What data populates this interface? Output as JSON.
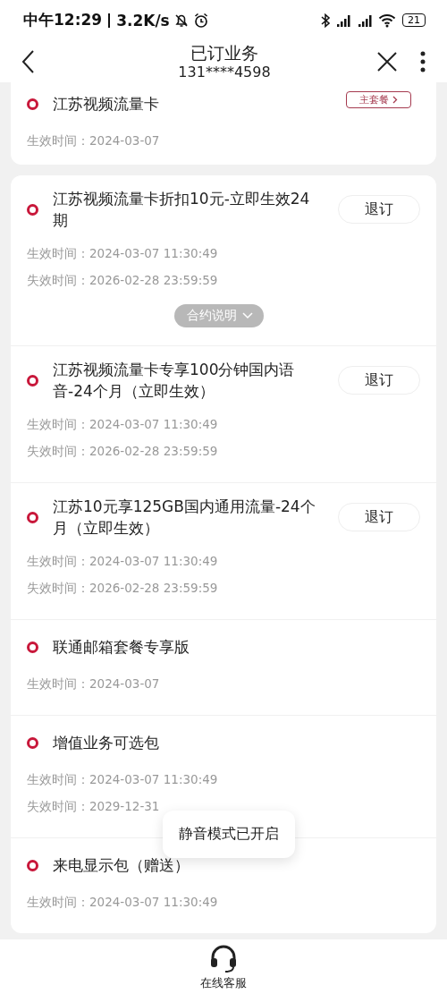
{
  "status_bar": {
    "time": "中午12:29",
    "speed": "3.2K/s",
    "battery": "21"
  },
  "header": {
    "title": "已订业务",
    "subtitle": "131****4598"
  },
  "main_plan": {
    "name": "江苏视频流量卡",
    "badge": "主套餐",
    "dates": [
      "生效时间：2024-03-07"
    ]
  },
  "services": [
    {
      "name": "江苏视频流量卡折扣10元-立即生效24期",
      "action": "退订",
      "dates": [
        "生效时间：2024-03-07 11:30:49",
        "失效时间：2026-02-28 23:59:59"
      ],
      "contract": "合约说明"
    },
    {
      "name": "江苏视频流量卡专享100分钟国内语音-24个月（立即生效）",
      "action": "退订",
      "dates": [
        "生效时间：2024-03-07 11:30:49",
        "失效时间：2026-02-28 23:59:59"
      ]
    },
    {
      "name": "江苏10元享125GB国内通用流量-24个月（立即生效）",
      "action": "退订",
      "dates": [
        "生效时间：2024-03-07 11:30:49",
        "失效时间：2026-02-28 23:59:59"
      ]
    },
    {
      "name": "联通邮箱套餐专享版",
      "dates": [
        "生效时间：2024-03-07"
      ]
    },
    {
      "name": "增值业务可选包",
      "dates": [
        "生效时间：2024-03-07 11:30:49",
        "失效时间：2029-12-31"
      ]
    },
    {
      "name": "来电显示包（赠送）",
      "dates": [
        "生效时间：2024-03-07 11:30:49"
      ]
    }
  ],
  "toast": "静音模式已开启",
  "footer": {
    "label": "在线客服"
  }
}
